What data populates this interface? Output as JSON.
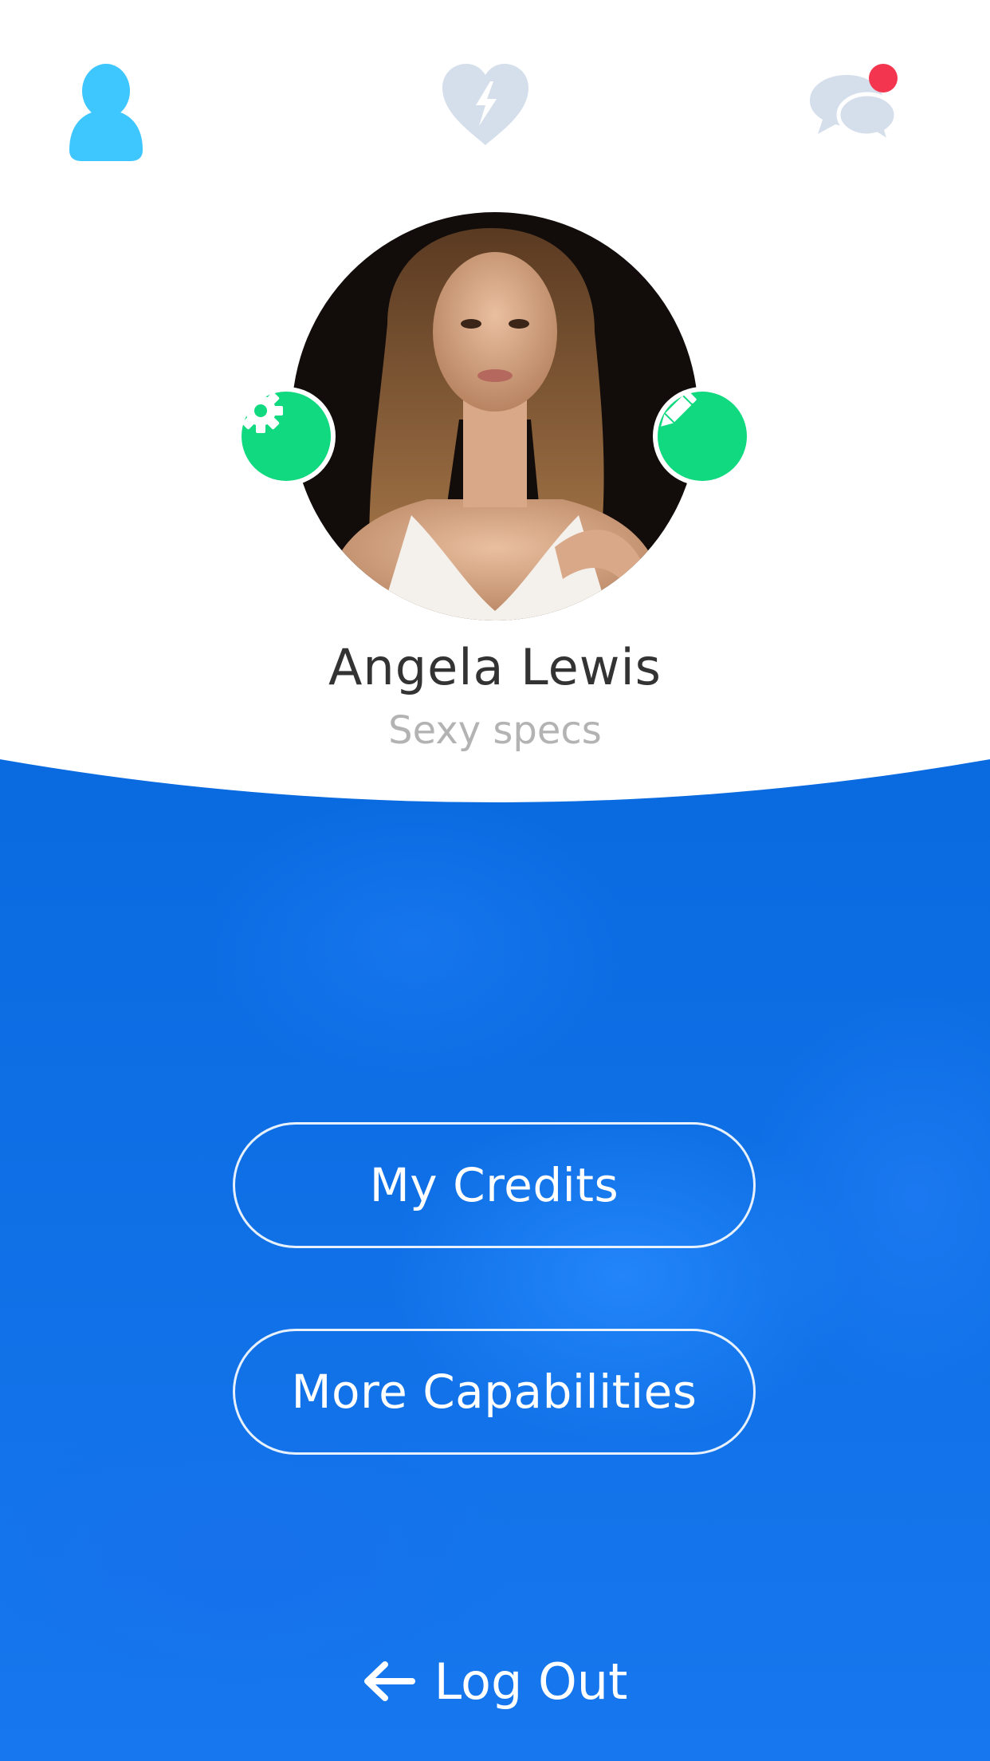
{
  "colors": {
    "accent_blue": "#0b6de4",
    "profile_icon_active": "#3ec6ff",
    "icon_inactive": "#d5dfeb",
    "badge_red": "#f4354f",
    "action_green": "#10d97f"
  },
  "tabs": [
    {
      "icon": "person-icon",
      "active": true
    },
    {
      "icon": "heart-bolt-icon",
      "active": false
    },
    {
      "icon": "chat-bubbles-icon",
      "active": false,
      "has_notification": true
    }
  ],
  "profile": {
    "name": "Angela Lewis",
    "tagline": "Sexy specs",
    "settings_icon": "gear-icon",
    "edit_icon": "pencil-icon"
  },
  "actions": {
    "credits_label": "My Credits",
    "capabilities_label": "More Capabilities",
    "logout_label": "Log Out",
    "logout_icon": "arrow-left-icon"
  }
}
